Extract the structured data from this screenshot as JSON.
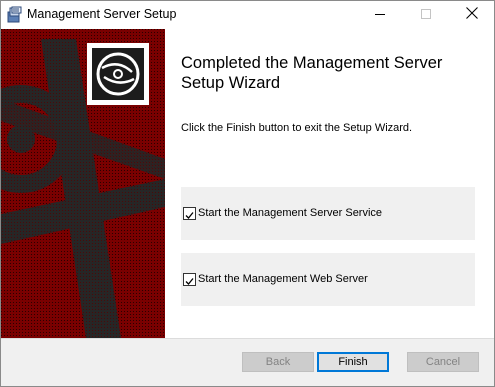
{
  "window": {
    "title": "Management Server Setup",
    "app_icon": "installer-icon",
    "controls": {
      "minimize": "minimize-icon",
      "maximize": "maximize-icon",
      "close": "close-icon"
    }
  },
  "banner": {
    "logo_icon": "disc-icon",
    "colors": {
      "accent": "#7a0000",
      "dark": "#1c1c1c"
    }
  },
  "content": {
    "heading": "Completed the Management Server Setup Wizard",
    "description": "Click the Finish button to exit the Setup Wizard.",
    "options": [
      {
        "label": "Start the Management Server Service",
        "checked": true
      },
      {
        "label": "Start the Management Web Server",
        "checked": true
      }
    ]
  },
  "buttons": {
    "back": "Back",
    "finish": "Finish",
    "cancel": "Cancel"
  }
}
